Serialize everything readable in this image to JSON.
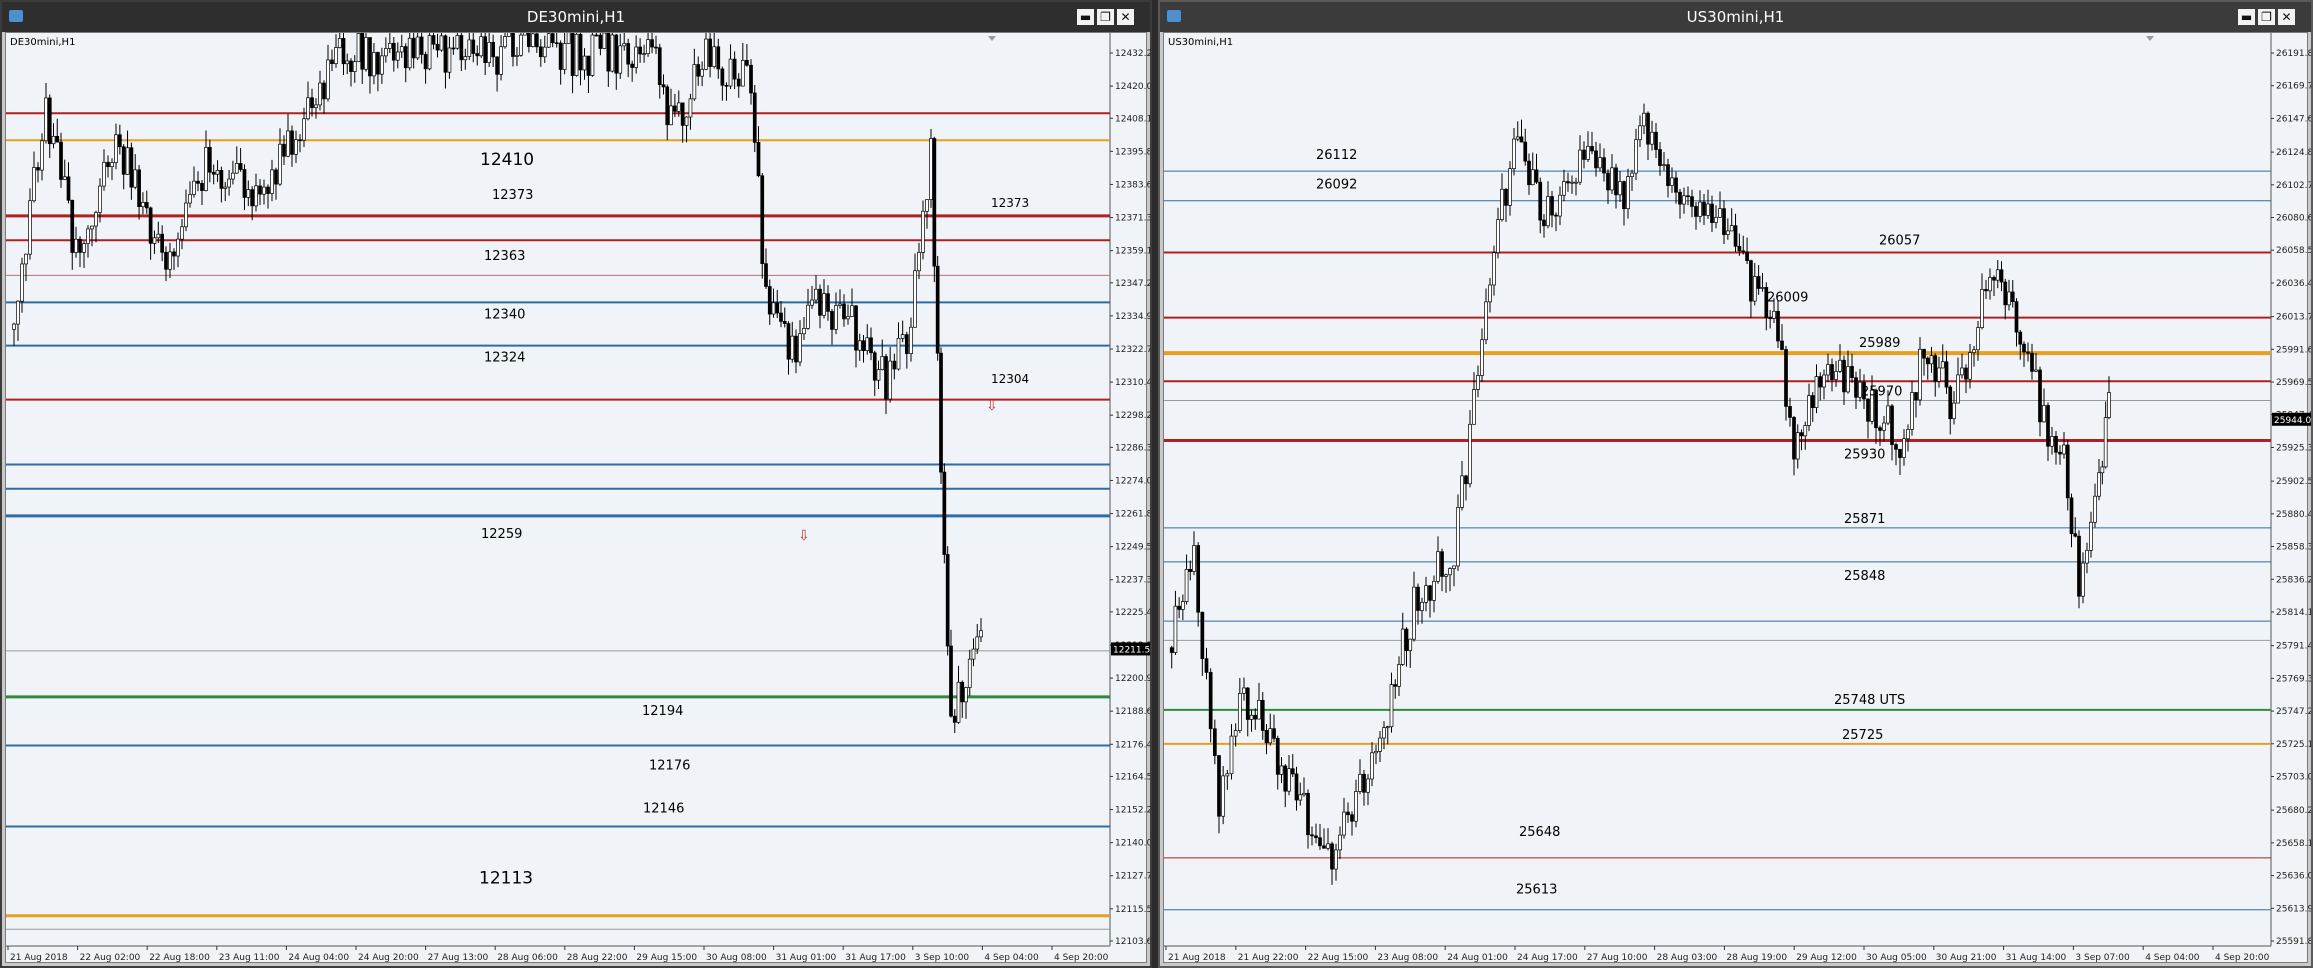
{
  "left": {
    "title": "DE30mini,H1",
    "symbol": "DE30mini,H1",
    "price_box": "12211.55",
    "price_ticks": [
      "12432.29",
      "12420.04",
      "12408.14",
      "12395.89",
      "12383.64",
      "12371.39",
      "12359.14",
      "12347.24",
      "12334.99",
      "12322.74",
      "12310.49",
      "12298.24",
      "12286.34",
      "12274.09",
      "12261.84",
      "12249.59",
      "12237.34",
      "12225.44",
      "12213.19",
      "12200.94",
      "12188.69",
      "12176.44",
      "12164.54",
      "12152.29",
      "12140.04",
      "12127.79",
      "12115.54",
      "12103.64"
    ],
    "time_ticks": [
      "21 Aug 2018",
      "22 Aug 02:00",
      "22 Aug 18:00",
      "23 Aug 11:00",
      "24 Aug 04:00",
      "24 Aug 20:00",
      "27 Aug 13:00",
      "28 Aug 06:00",
      "28 Aug 22:00",
      "29 Aug 15:00",
      "30 Aug 08:00",
      "31 Aug 01:00",
      "31 Aug 17:00",
      "3 Sep 10:00",
      "4 Sep 04:00",
      "4 Sep 20:00"
    ],
    "levels": [
      {
        "price": "12410",
        "color": "#b02020",
        "label": "",
        "width": 2
      },
      {
        "price": "12400",
        "color": "#e6a020",
        "label": "12410",
        "width": 2
      },
      {
        "price": "12372",
        "color": "#b02020",
        "label": "12373",
        "width": 3
      },
      {
        "price": "12363",
        "color": "#b02020",
        "label": "12363",
        "width": 2
      },
      {
        "price": "12350",
        "color": "#c07070",
        "label": "",
        "width": 1
      },
      {
        "price": "12340",
        "color": "#2e6da4",
        "label": "12340",
        "width": 2
      },
      {
        "price": "12324",
        "color": "#2e6da4",
        "label": "12324",
        "width": 2
      },
      {
        "price": "12304",
        "color": "#b02020",
        "label": "",
        "width": 2
      },
      {
        "price": "12280",
        "color": "#2e6da4",
        "label": "",
        "width": 2
      },
      {
        "price": "12271",
        "color": "#2e6da4",
        "label": "",
        "width": 2
      },
      {
        "price": "12261",
        "color": "#2e6da4",
        "label": "12259",
        "width": 3
      },
      {
        "price": "12211",
        "color": "#9a9a9a",
        "label": "",
        "width": 1
      },
      {
        "price": "12194",
        "color": "#2e8b3e",
        "label": "12194",
        "width": 3
      },
      {
        "price": "12176",
        "color": "#2e6da4",
        "label": "12176",
        "width": 2
      },
      {
        "price": "12146",
        "color": "#2e6da4",
        "label": "12146",
        "width": 2
      },
      {
        "price": "12113",
        "color": "#e6a020",
        "label": "12113",
        "width": 3
      },
      {
        "price": "12108",
        "color": "#9a9a9a",
        "label": "",
        "width": 1
      }
    ],
    "side_labels": [
      {
        "text": "12373",
        "price": "12373"
      },
      {
        "text": "12304",
        "price": "12308"
      }
    ]
  },
  "right": {
    "title": "US30mini,H1",
    "symbol": "US30mini,H1",
    "price_box": "25944.00",
    "price_ticks": [
      "26191.80",
      "26169.70",
      "26147.60",
      "26124.85",
      "26102.75",
      "26080.65",
      "26058.55",
      "26036.45",
      "26013.70",
      "25991.60",
      "25969.50",
      "25947.40",
      "25925.30",
      "25902.55",
      "25880.45",
      "25858.35",
      "25836.25",
      "25814.15",
      "25791.40",
      "25769.30",
      "25747.20",
      "25725.10",
      "25703.00",
      "25680.25",
      "25658.15",
      "25636.05",
      "25613.95",
      "25591.85"
    ],
    "time_ticks": [
      "21 Aug 2018",
      "21 Aug 22:00",
      "22 Aug 15:00",
      "23 Aug 08:00",
      "24 Aug 01:00",
      "24 Aug 17:00",
      "27 Aug 10:00",
      "28 Aug 03:00",
      "28 Aug 19:00",
      "29 Aug 12:00",
      "30 Aug 05:00",
      "30 Aug 21:00",
      "31 Aug 14:00",
      "3 Sep 07:00",
      "4 Sep 04:00",
      "4 Sep 20:00"
    ],
    "levels": [
      {
        "price": "26112",
        "color": "#2e6da4",
        "label": "26112",
        "width": 1
      },
      {
        "price": "26092",
        "color": "#2e6da4",
        "label": "26092",
        "width": 1
      },
      {
        "price": "26057",
        "color": "#b02020",
        "label": "26057",
        "width": 2
      },
      {
        "price": "26013",
        "color": "#b02020",
        "label": "26009",
        "width": 2
      },
      {
        "price": "25989",
        "color": "#e6a020",
        "label": "25989",
        "width": 4
      },
      {
        "price": "25970",
        "color": "#b02020",
        "label": "25970",
        "width": 2
      },
      {
        "price": "25957",
        "color": "#9a9a9a",
        "label": "",
        "width": 1
      },
      {
        "price": "25930",
        "color": "#b02020",
        "label": "25930",
        "width": 3
      },
      {
        "price": "25871",
        "color": "#2e6da4",
        "label": "25871",
        "width": 1
      },
      {
        "price": "25848",
        "color": "#2e6da4",
        "label": "25848",
        "width": 1
      },
      {
        "price": "25808",
        "color": "#2e6da4",
        "label": "",
        "width": 1
      },
      {
        "price": "25795",
        "color": "#9a9a9a",
        "label": "",
        "width": 1
      },
      {
        "price": "25748",
        "color": "#2e8b3e",
        "label": "25748 UTS",
        "width": 2
      },
      {
        "price": "25725",
        "color": "#e6a020",
        "label": "25725",
        "width": 2
      },
      {
        "price": "25648",
        "color": "#b02020",
        "label": "25648",
        "width": 1
      },
      {
        "price": "25613",
        "color": "#2e6da4",
        "label": "25613",
        "width": 1
      }
    ]
  },
  "buttons": {
    "minimize": "▬",
    "restore": "❐",
    "close": "✕"
  }
}
